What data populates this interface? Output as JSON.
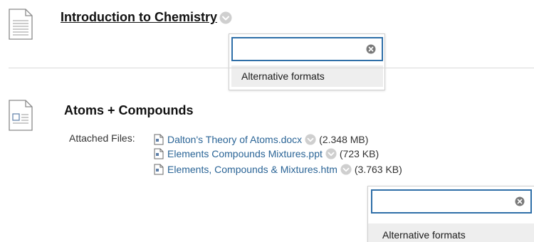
{
  "content_item_1": {
    "title": "Introduction to Chemistry",
    "icon": "document-icon"
  },
  "menu_1": {
    "search_value": "",
    "option": "Alternative formats"
  },
  "content_item_2": {
    "title": "Atoms + Compounds",
    "icon": "document-with-attachment-icon",
    "attached_label": "Attached Files:",
    "files": [
      {
        "name": "Dalton's Theory of Atoms.docx",
        "size": "(2.348 MB)"
      },
      {
        "name": "Elements Compounds Mixtures.ppt",
        "size": "(723 KB)"
      },
      {
        "name": "Elements, Compounds & Mixtures.htm",
        "size": "(3.763 KB)"
      }
    ]
  },
  "menu_2": {
    "search_value": "",
    "option": "Alternative formats"
  },
  "colors": {
    "link": "#2a6496",
    "focus_border": "#2f6fa8",
    "option_bg": "#eeeeee",
    "chevron": "#c8c8c8"
  }
}
